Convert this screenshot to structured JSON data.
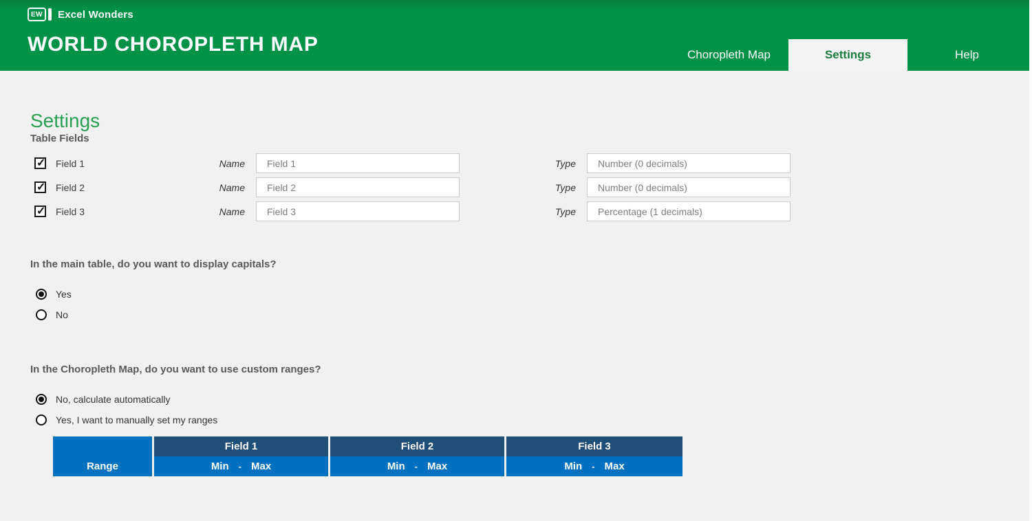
{
  "header": {
    "logo_icon_text": "EW",
    "brand_name": "Excel Wonders",
    "title": "WORLD CHOROPLETH MAP",
    "tabs": [
      {
        "label": "Choropleth Map",
        "active": false
      },
      {
        "label": "Settings",
        "active": true
      },
      {
        "label": "Help",
        "active": false
      }
    ]
  },
  "page": {
    "heading": "Settings",
    "table_fields": {
      "section_title": "Table Fields",
      "name_label": "Name",
      "type_label": "Type",
      "rows": [
        {
          "checked": true,
          "label": "Field 1",
          "name_value": "Field 1",
          "type_value": "Number (0 decimals)"
        },
        {
          "checked": true,
          "label": "Field 2",
          "name_value": "Field 2",
          "type_value": "Number (0 decimals)"
        },
        {
          "checked": true,
          "label": "Field 3",
          "name_value": "Field 3",
          "type_value": "Percentage (1 decimals)"
        }
      ]
    },
    "capitals_question": {
      "text": "In the main table, do you want to display capitals?",
      "options": [
        {
          "label": "Yes",
          "selected": true
        },
        {
          "label": "No",
          "selected": false
        }
      ]
    },
    "ranges_question": {
      "text": "In the Choropleth Map, do you want to use custom ranges?",
      "options": [
        {
          "label": "No, calculate automatically",
          "selected": true
        },
        {
          "label": "Yes, I want to manually set my ranges",
          "selected": false
        }
      ]
    },
    "ranges_table": {
      "range_header": "Range",
      "field_headers": [
        "Field 1",
        "Field 2",
        "Field 3"
      ],
      "min_label": "Min",
      "dash": "-",
      "max_label": "Max"
    }
  },
  "colors": {
    "header_green": "#009247",
    "active_tab_text_green": "#1e7c3e",
    "heading_green": "#28a052",
    "table_dark_blue": "#1f4e79",
    "table_blue": "#0070c0",
    "content_background": "#f1f1f1"
  }
}
